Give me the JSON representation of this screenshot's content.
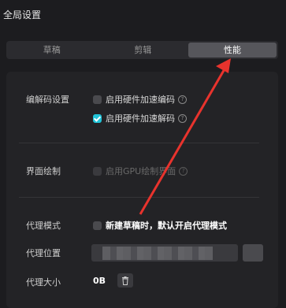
{
  "window": {
    "title": "全局设置"
  },
  "tabs": [
    {
      "label": "草稿",
      "active": false
    },
    {
      "label": "剪辑",
      "active": false
    },
    {
      "label": "性能",
      "active": true
    }
  ],
  "codec": {
    "label": "编解码设置",
    "options": [
      {
        "label": "启用硬件加速编码",
        "checked": false
      },
      {
        "label": "启用硬件加速解码",
        "checked": true
      }
    ]
  },
  "ui_render": {
    "label": "界面绘制",
    "option": {
      "label": "启用GPU绘制界面",
      "checked": false,
      "disabled": true
    }
  },
  "proxy_mode": {
    "label": "代理模式",
    "option": {
      "label": "新建草稿时，默认开启代理模式",
      "checked": false
    }
  },
  "proxy_location": {
    "label": "代理位置"
  },
  "proxy_size": {
    "label": "代理大小",
    "value": "0B"
  },
  "colors": {
    "accent": "#21c4d8",
    "annotation": "#e8332d"
  },
  "icons": {
    "help": "help-circle-icon",
    "trash": "trash-icon",
    "folder": "folder-icon"
  }
}
